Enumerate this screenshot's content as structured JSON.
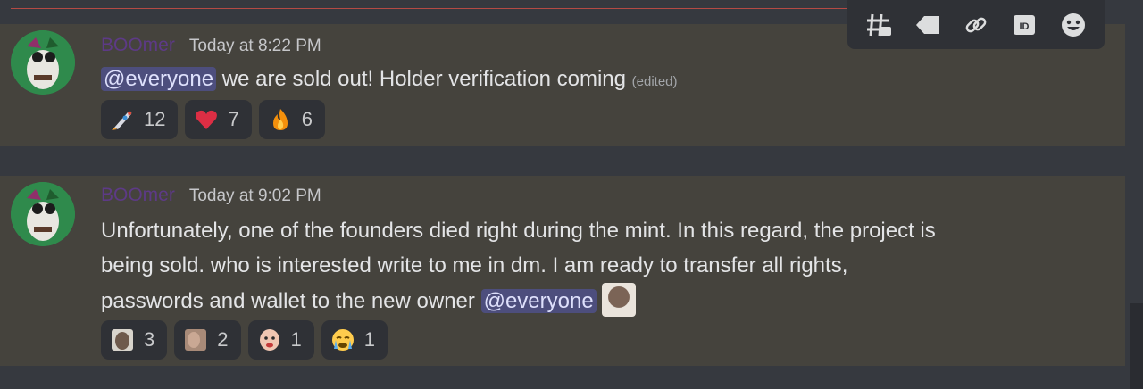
{
  "toolbar": {
    "buttons": [
      {
        "icon": "add-thread-icon"
      },
      {
        "icon": "tag-icon"
      },
      {
        "icon": "link-icon"
      },
      {
        "icon": "id-icon",
        "label": "ID"
      },
      {
        "icon": "add-reaction-icon"
      }
    ]
  },
  "messages": [
    {
      "username": "BOOmer",
      "timestamp": "Today at 8:22 PM",
      "mention": "@everyone",
      "text": "we are sold out! Holder verification coming",
      "edited": "(edited)",
      "reactions": [
        {
          "emoji": "rocket-emoji",
          "count": "12"
        },
        {
          "emoji": "heart-emoji",
          "count": "7"
        },
        {
          "emoji": "fire-emoji",
          "count": "6"
        }
      ]
    },
    {
      "username": "BOOmer",
      "timestamp": "Today at 9:02 PM",
      "text_line1": "Unfortunately, one of the founders died right during the mint. In this regard, the project is",
      "text_line2": "being sold. who is interested write to me in dm. I am ready to transfer all rights,",
      "text_line3": "passwords and wallet to the new owner",
      "mention": "@everyone",
      "reactions": [
        {
          "emoji": "custom-face-emoji",
          "count": "3"
        },
        {
          "emoji": "custom-face-emoji",
          "count": "2"
        },
        {
          "emoji": "custom-face-emoji",
          "count": "1"
        },
        {
          "emoji": "crying-face-emoji",
          "count": "1"
        }
      ]
    }
  ]
}
